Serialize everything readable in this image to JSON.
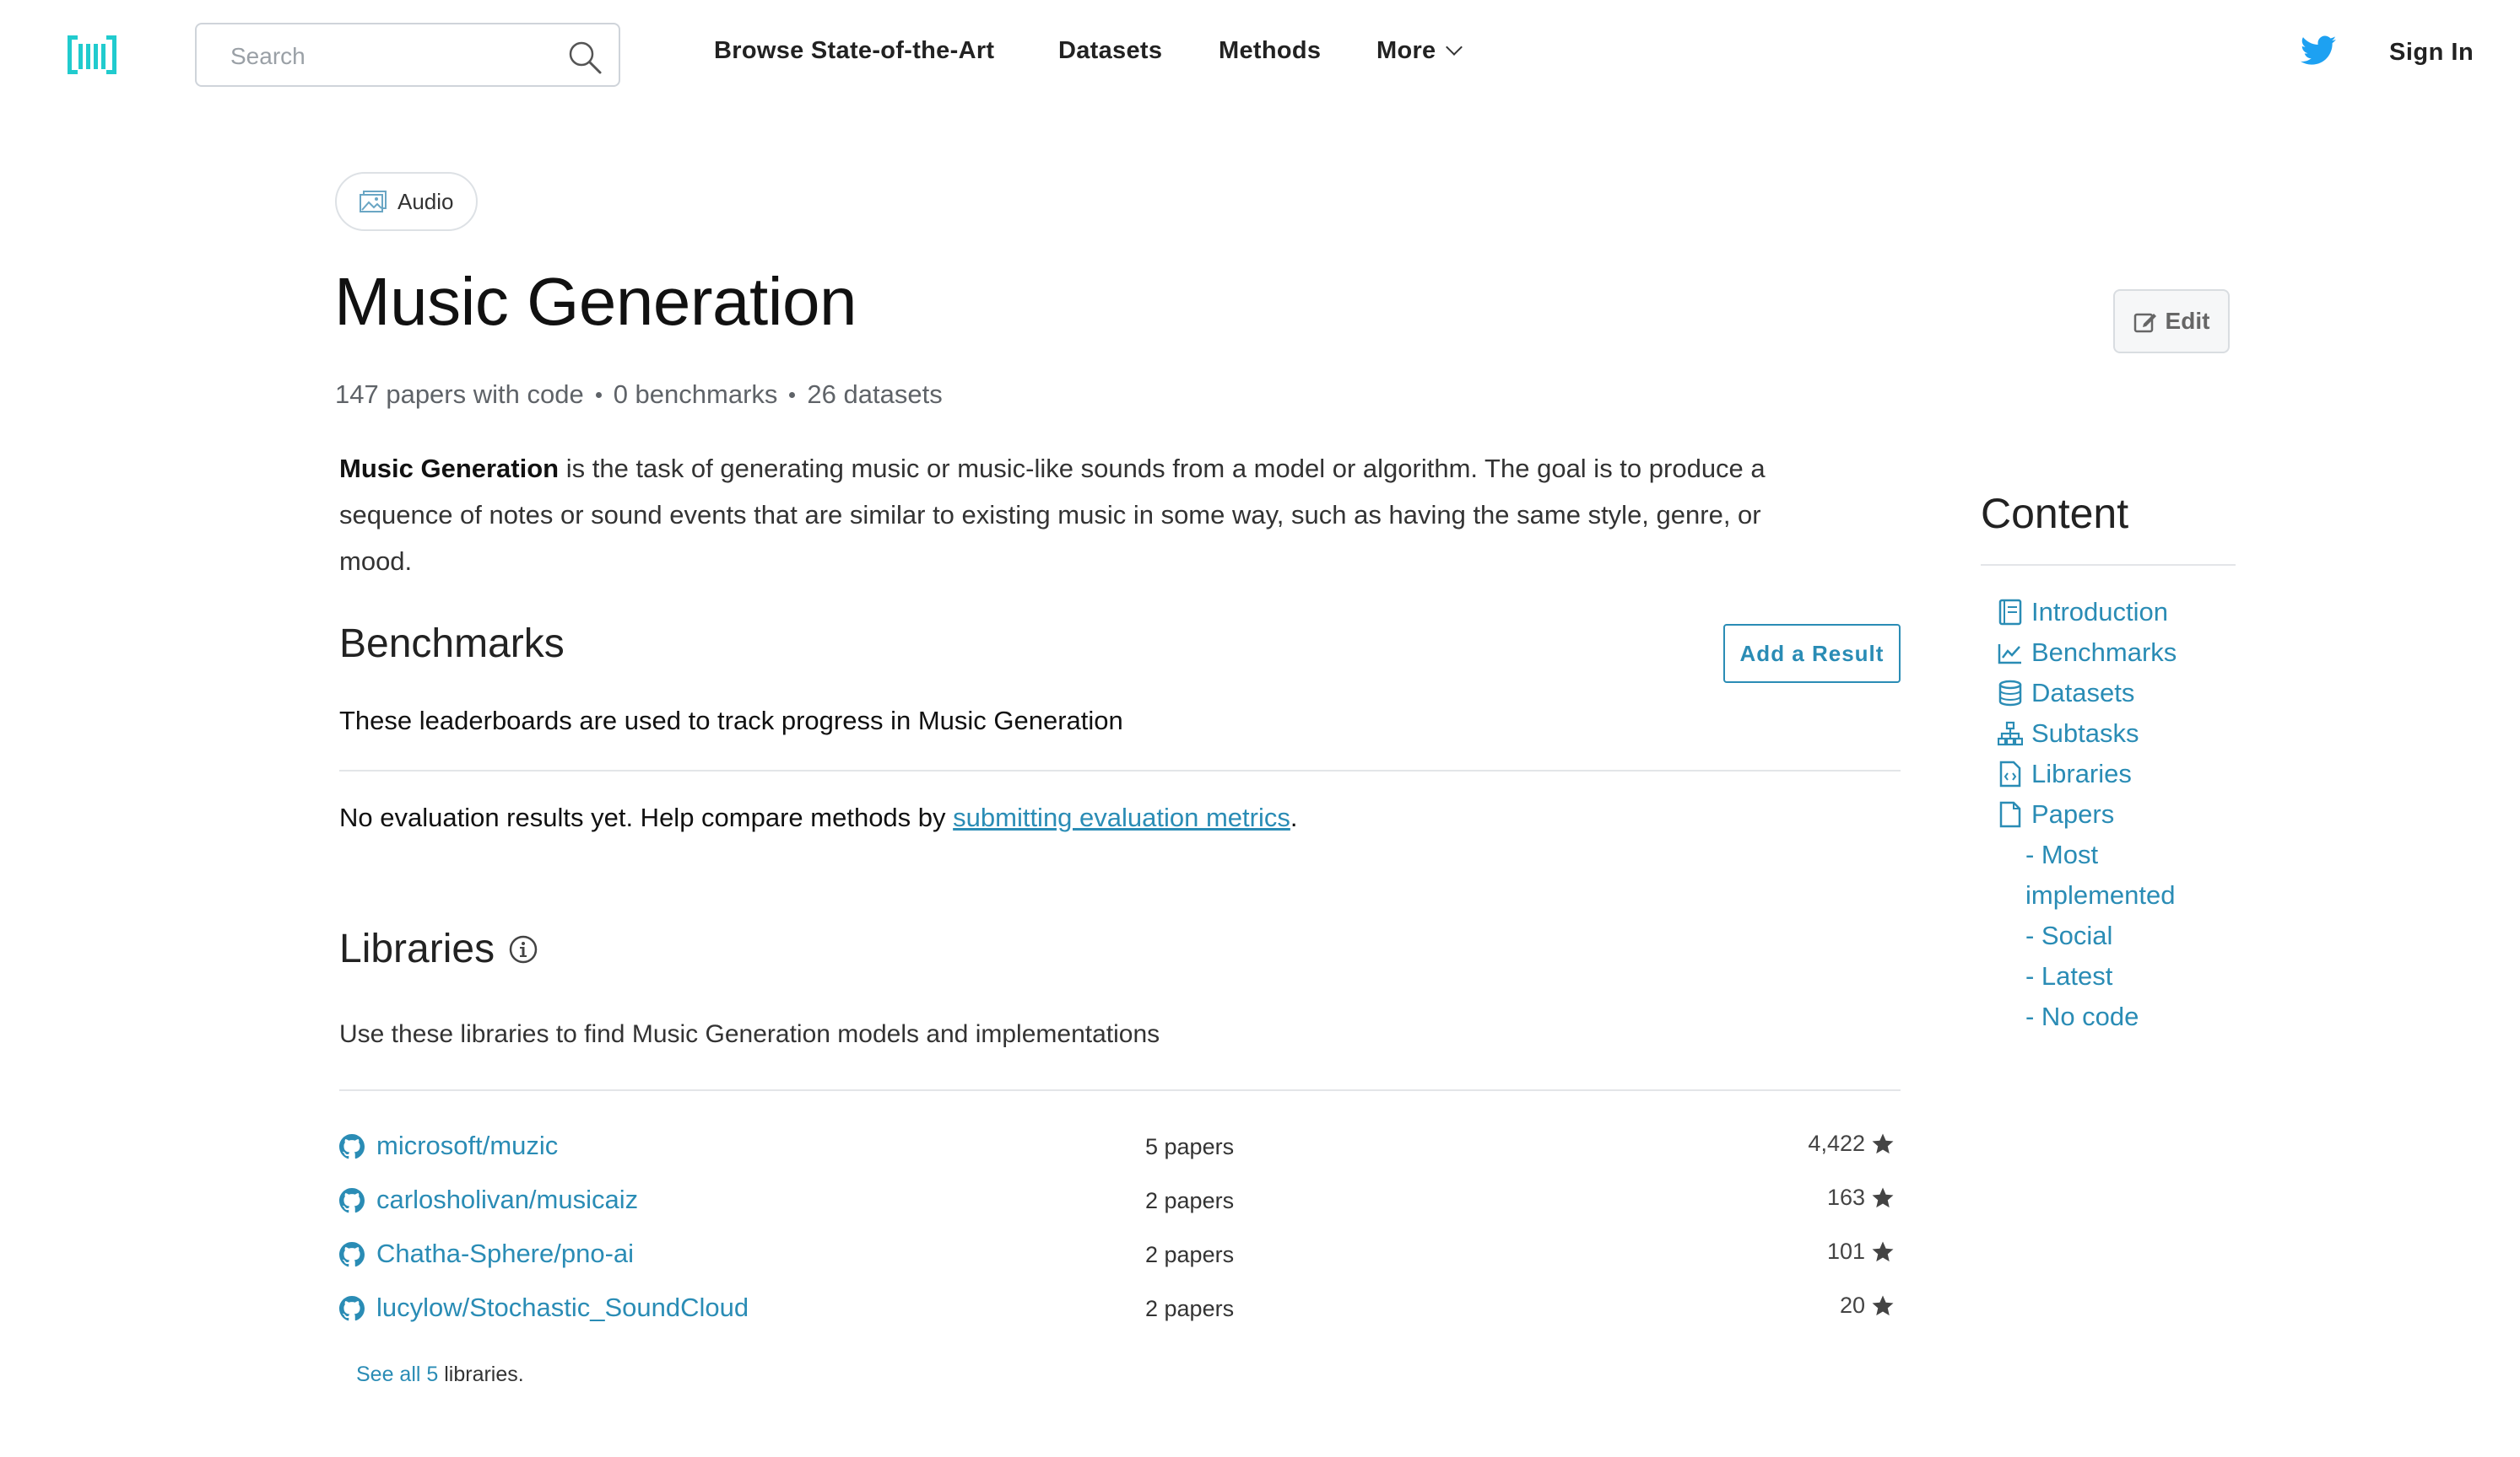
{
  "header": {
    "search_placeholder": "Search",
    "nav": [
      "Browse State-of-the-Art",
      "Datasets",
      "Methods",
      "More"
    ],
    "signin": "Sign In"
  },
  "task": {
    "area": "Audio",
    "title": "Music Generation",
    "edit_label": "Edit",
    "stats": {
      "papers": "147 papers with code",
      "benchmarks": "0 benchmarks",
      "datasets": "26 datasets"
    },
    "description_bold": "Music Generation",
    "description_rest": " is the task of generating music or music-like sounds from a model or algorithm. The goal is to produce a sequence of notes or sound events that are similar to existing music in some way, such as having the same style, genre, or mood."
  },
  "benchmarks": {
    "title": "Benchmarks",
    "add_result": "Add a Result",
    "subtitle": "These leaderboards are used to track progress in Music Generation",
    "no_results_prefix": "No evaluation results yet. Help compare methods by ",
    "no_results_link": "submitting evaluation metrics",
    "no_results_suffix": "."
  },
  "libraries": {
    "title": "Libraries",
    "subtitle": "Use these libraries to find Music Generation models and implementations",
    "items": [
      {
        "name": "microsoft/muzic",
        "papers": "5 papers",
        "stars": "4,422"
      },
      {
        "name": "carlosholivan/musicaiz",
        "papers": "2 papers",
        "stars": "163"
      },
      {
        "name": "Chatha-Sphere/pno-ai",
        "papers": "2 papers",
        "stars": "101"
      },
      {
        "name": "lucylow/Stochastic_SoundCloud",
        "papers": "2 papers",
        "stars": "20"
      }
    ],
    "see_all_link": "See all 5",
    "see_all_suffix": " libraries."
  },
  "sidebar": {
    "title": "Content",
    "items": [
      "Introduction",
      "Benchmarks",
      "Datasets",
      "Subtasks",
      "Libraries",
      "Papers"
    ],
    "paper_subitems": [
      "- Most",
      "implemented",
      "- Social",
      "- Latest",
      "- No code"
    ]
  },
  "colors": {
    "accent": "#2a8cb5",
    "logo": "#21cbce",
    "twitter": "#1da1f2"
  }
}
